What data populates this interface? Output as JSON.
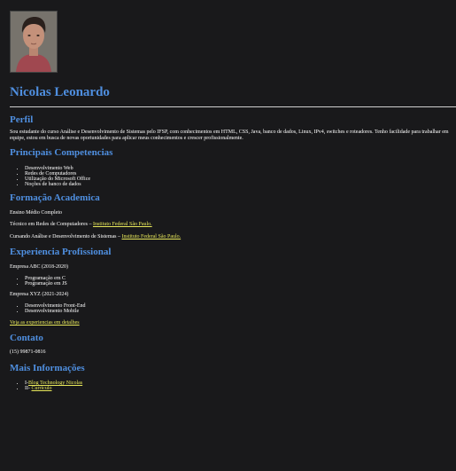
{
  "profile": {
    "name": "Nicolas Leonardo"
  },
  "perfil": {
    "heading": "Perfil",
    "text": "Sou estudante do curso Análise e Desenvolvimento de Sistemas pelo IFSP, com conhecimentos em HTML, CSS, Java, banco de dados, Linux, IPv4, switches e roteadores. Tenho facilidade para trabalhar em equipe, estou em busca de novas oportunidades para aplicar meus conhecimentos e crescer profissionalmente."
  },
  "competencias": {
    "heading": "Principais Competencias",
    "items": [
      "Desenvolvimento Web",
      "Redes de Computadores",
      "Utilização do Microsoft Office",
      "Noções de banco de dados"
    ]
  },
  "formacao": {
    "heading": "Formação Academica",
    "entries": [
      {
        "text": "Ensino Médio Completo",
        "link": ""
      },
      {
        "text": "Técnico em Redes de Computadores – ",
        "link": "Instituto Federal São Paulo."
      },
      {
        "text": "Cursando Análise e Desenvolvimento de Sistemas – ",
        "link": "Instituto Federal São Paulo."
      }
    ]
  },
  "experiencia": {
    "heading": "Experiencia Profissional",
    "jobs": [
      {
        "company": "Empresa ABC (2018-2020)",
        "items": [
          "Programação em C",
          "Programação em JS"
        ]
      },
      {
        "company": "Empresa XYZ (2021-2024)",
        "items": [
          "Desenvolvimento Front-End",
          "Desenvolvimento Mobile"
        ]
      }
    ],
    "details_link": "Veja as experiencias em detalhes"
  },
  "contato": {
    "heading": "Contato",
    "phone": "(15) 99871-0816"
  },
  "mais": {
    "heading": "Mais Informações",
    "items": [
      {
        "prefix": "I-",
        "link": "Blog Technology Nicolas"
      },
      {
        "prefix": "II- ",
        "link": "Curriculo"
      }
    ]
  },
  "colors": {
    "background": "#19191b",
    "heading": "#4f8fe0",
    "link": "#e8e85a",
    "text": "#ffffff"
  }
}
